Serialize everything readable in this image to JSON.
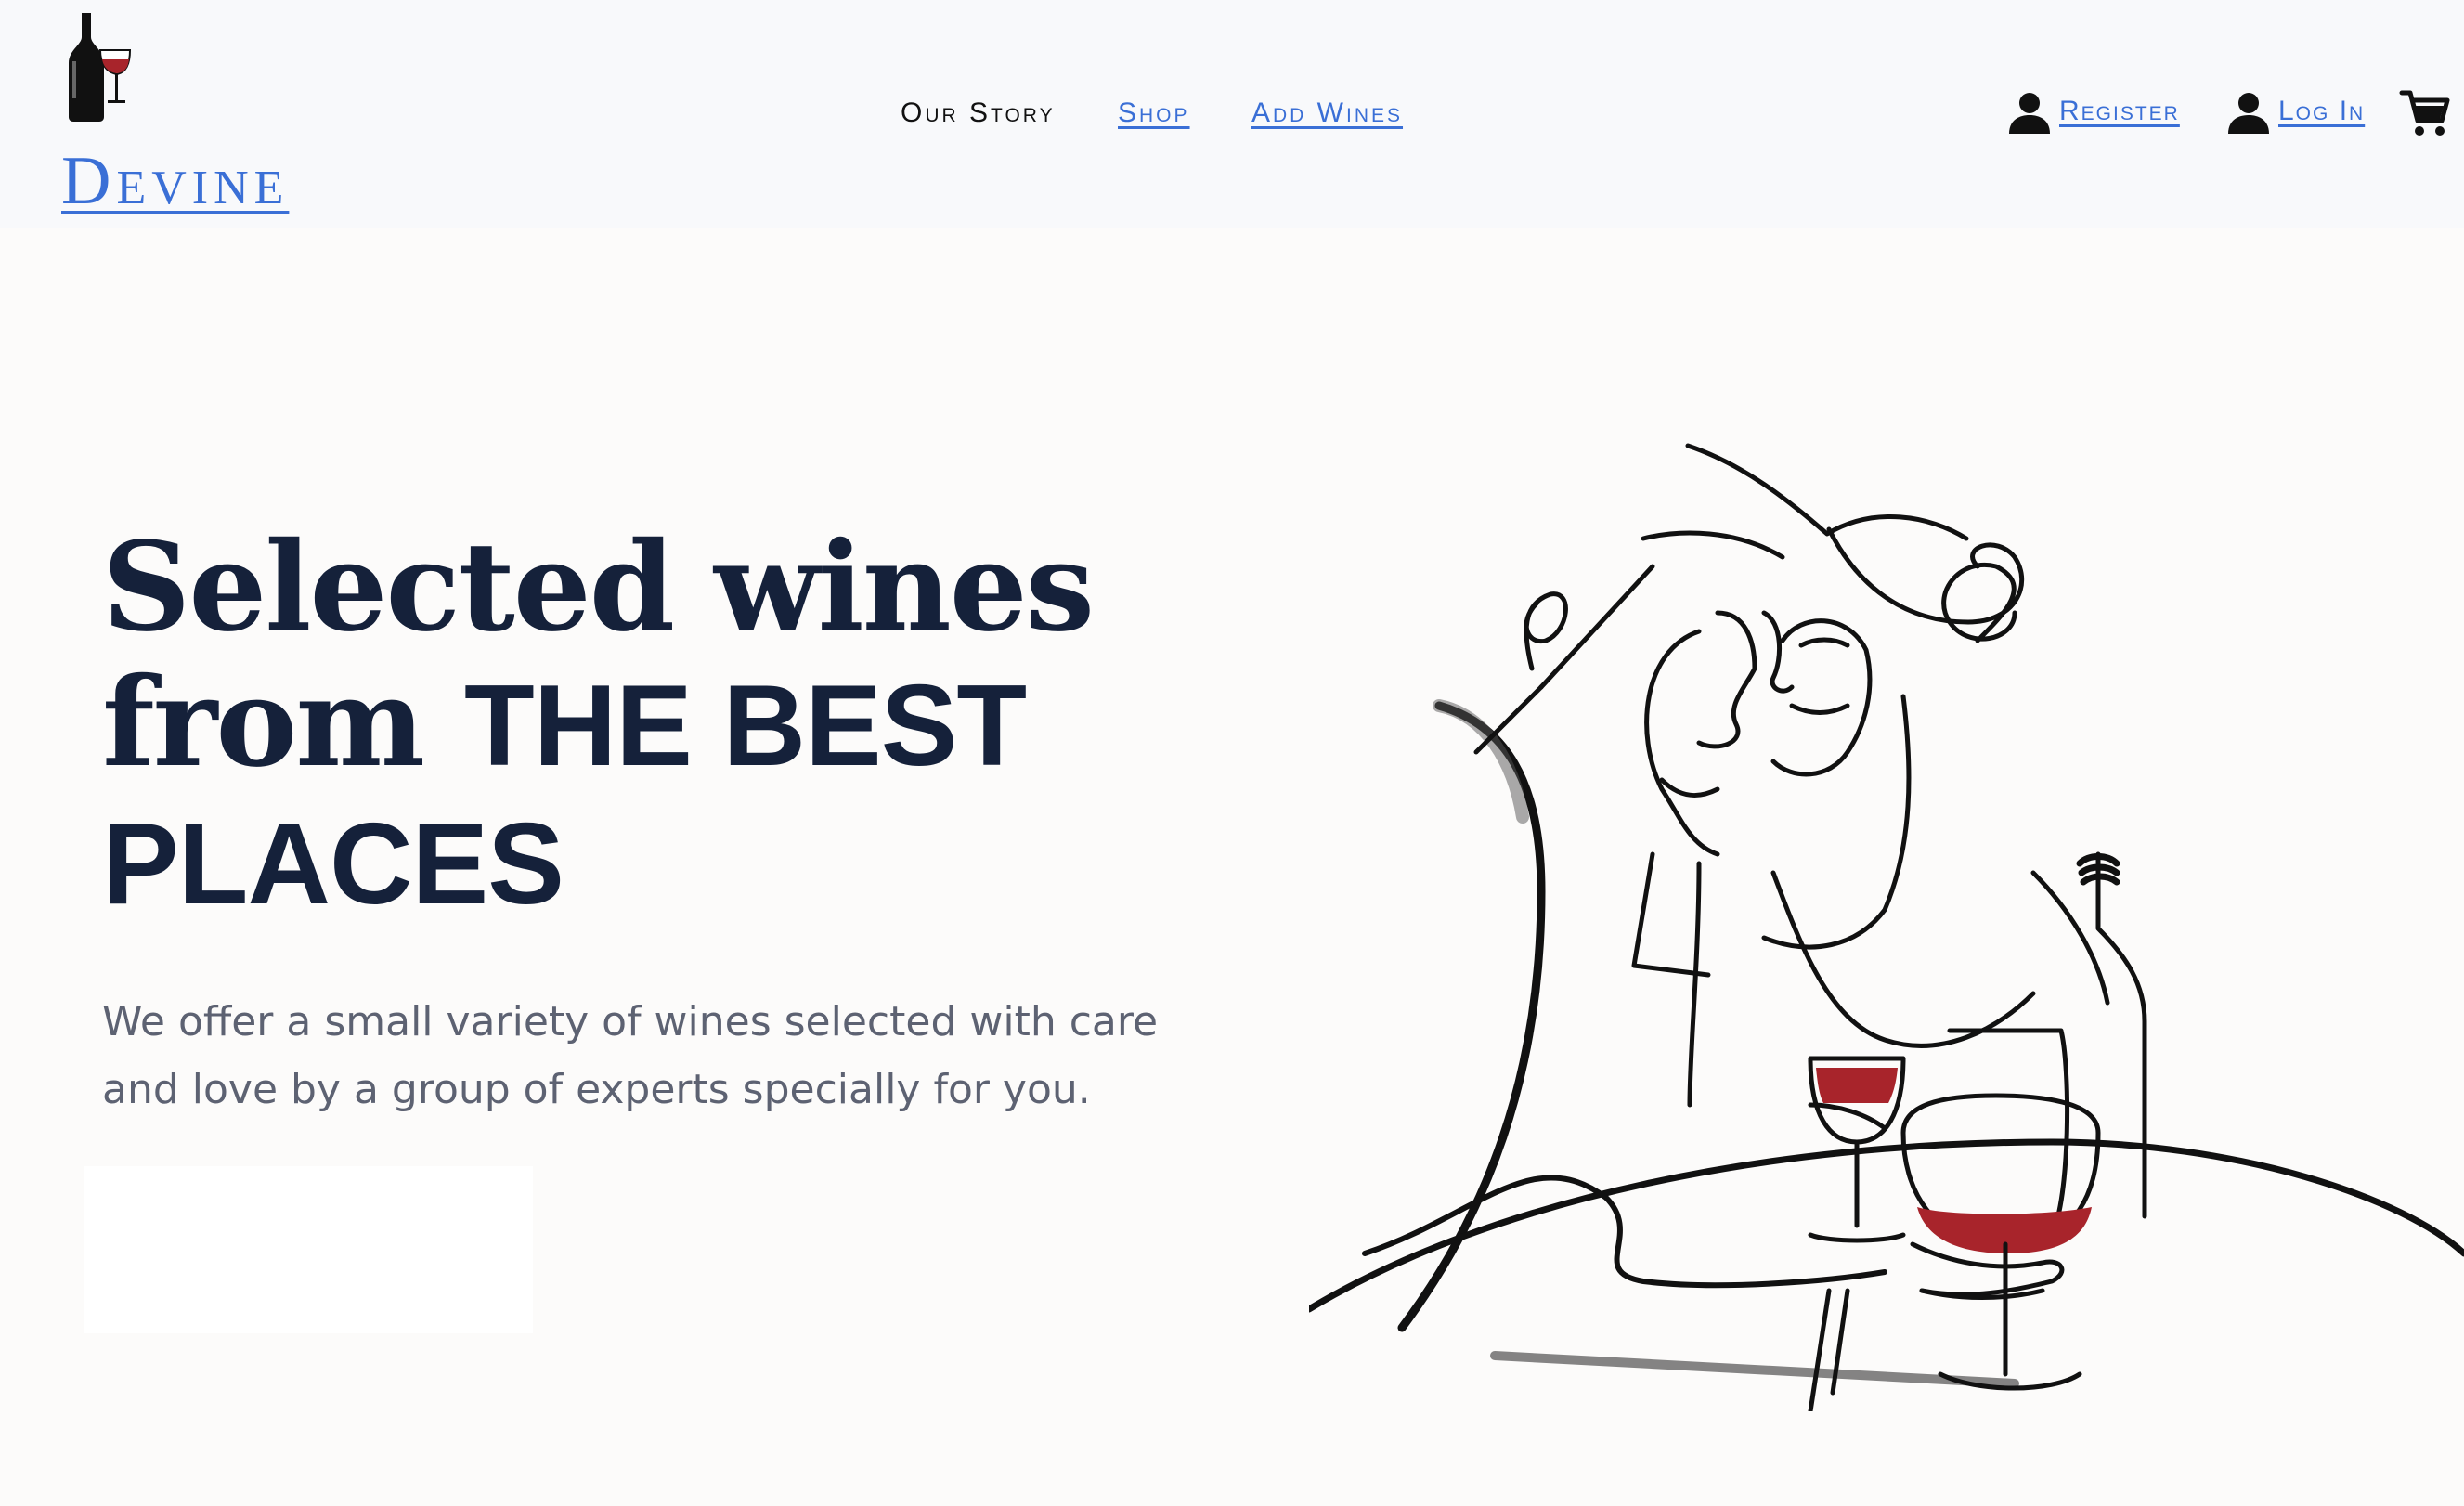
{
  "brand": {
    "name": "Devine"
  },
  "nav": {
    "our_story": "Our Story",
    "shop": "Shop",
    "add_wines": "Add Wines"
  },
  "account": {
    "register": "Register",
    "login": "Log In"
  },
  "hero": {
    "title_line1": "Selected wines",
    "title_from": "from ",
    "title_emph1": "THE BEST",
    "title_emph2": "PLACES",
    "subtitle_line1": "We offer a small variety of wines selected with care",
    "subtitle_line2": "and love by a group of experts specially for you.",
    "cta_label": ""
  },
  "icons": {
    "logo": "wine-bottle-glass-icon",
    "user": "user-icon",
    "cart": "cart-icon"
  },
  "colors": {
    "header_bg": "#f8f9fb",
    "page_bg": "#fcfbfa",
    "link_blue": "#3a6fd6",
    "title_navy": "#15213a",
    "wine_red": "#a8242b"
  }
}
